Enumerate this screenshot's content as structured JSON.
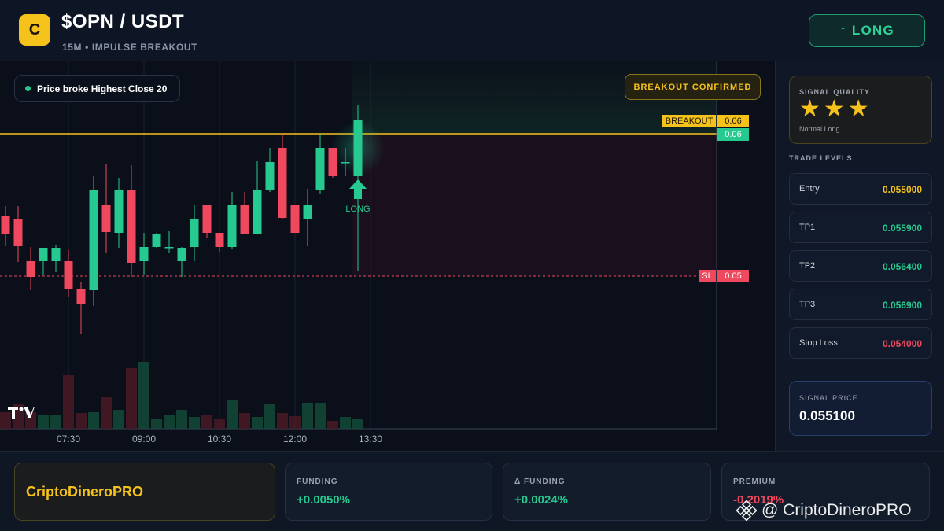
{
  "header": {
    "logo_letter": "C",
    "pair": "$OPN / USDT",
    "subtitle": "15M • IMPULSE BREAKOUT",
    "direction_button": "↑ LONG"
  },
  "chart": {
    "info_pill": "Price broke Highest Close 20",
    "status_badge": "BREAKOUT CONFIRMED",
    "breakout_tag": "BREAKOUT",
    "breakout_value": "0.06",
    "price_tag": "0.06",
    "sl_tag": "SL",
    "sl_value": "0.05",
    "signal_marker": "LONG",
    "tv_logo": "TV",
    "time_labels": [
      "07:30",
      "09:00",
      "10:30",
      "12:00",
      "13:30"
    ]
  },
  "chart_data": {
    "type": "candlestick",
    "x": [
      "07:00",
      "07:15",
      "07:30",
      "07:45",
      "08:00",
      "08:15",
      "08:30",
      "08:45",
      "09:00",
      "09:15",
      "09:30",
      "09:45",
      "10:00",
      "10:15",
      "10:30",
      "10:45",
      "11:00",
      "11:15",
      "11:30",
      "11:45",
      "12:00",
      "12:15",
      "12:30",
      "12:45",
      "13:00",
      "13:15",
      "13:30",
      "13:45"
    ],
    "levels": {
      "breakout": 0.0552,
      "stop_loss": 0.054
    },
    "colors": {
      "up": "#26c98f",
      "down": "#f0485e",
      "breakout": "#f5c21b"
    }
  },
  "signal_quality": {
    "title": "SIGNAL QUALITY",
    "stars": "★★★",
    "subtitle": "Normal Long"
  },
  "trade_levels": {
    "title": "TRADE LEVELS",
    "items": [
      {
        "label": "Entry",
        "value": "0.055000",
        "color": "#f5c21b"
      },
      {
        "label": "TP1",
        "value": "0.055900",
        "color": "#26c98f"
      },
      {
        "label": "TP2",
        "value": "0.056400",
        "color": "#26c98f"
      },
      {
        "label": "TP3",
        "value": "0.056900",
        "color": "#26c98f"
      },
      {
        "label": "Stop Loss",
        "value": "0.054000",
        "color": "#f0485e"
      }
    ]
  },
  "signal_price": {
    "title": "SIGNAL PRICE",
    "value": "0.055100"
  },
  "footer": {
    "brand": "CriptoDineroPRO",
    "funding": {
      "title": "FUNDING",
      "value": "+0.0050%"
    },
    "delta_funding": {
      "title": "Δ FUNDING",
      "value": "+0.0024%"
    },
    "premium": {
      "title": "PREMIUM",
      "value": "-0.2019%"
    },
    "watermark": "@ CriptoDineroPRO"
  }
}
